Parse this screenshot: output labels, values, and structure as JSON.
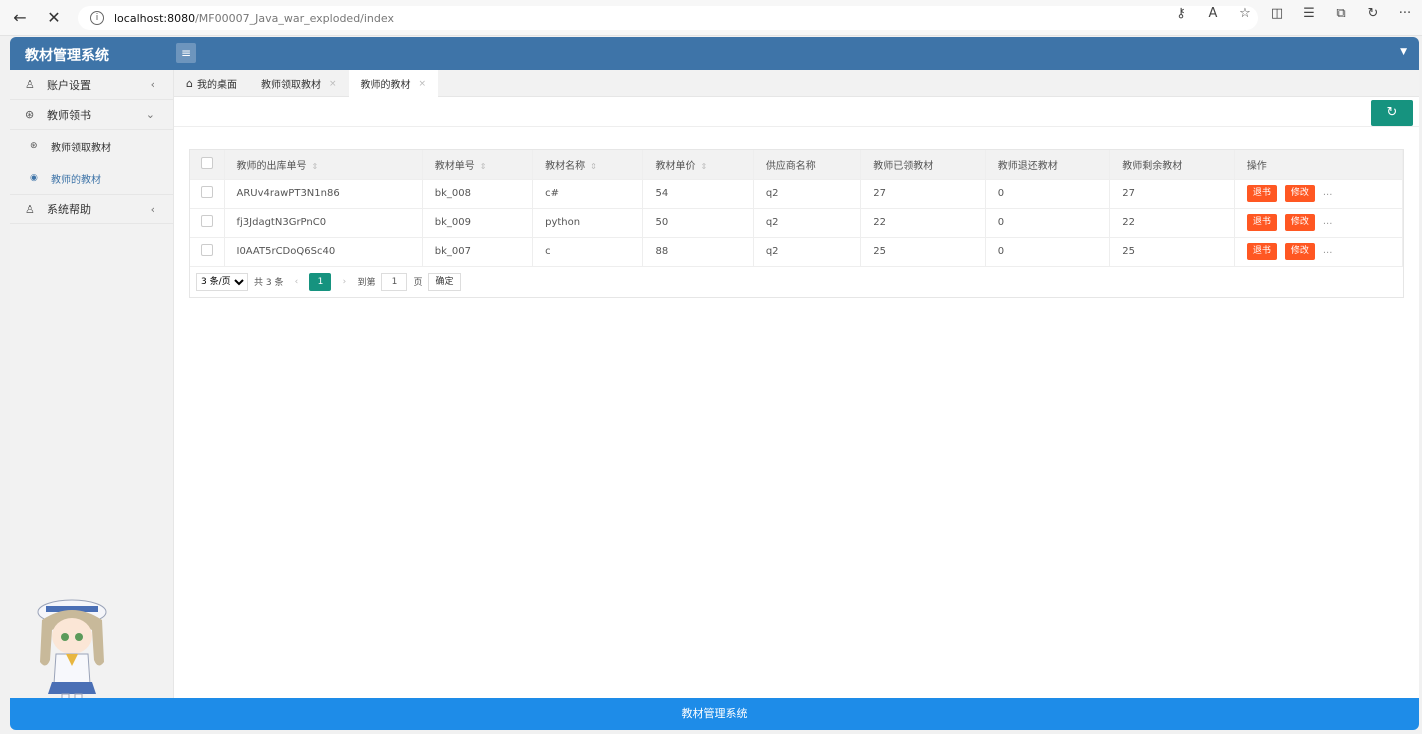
{
  "browser": {
    "back": "←",
    "close": "✕",
    "info": "i",
    "url_host": "localhost:8080",
    "url_path": "/MF00007_Java_war_exploded/index",
    "icons": [
      "key-icon",
      "read-aloud-icon",
      "favorite-icon",
      "split-icon",
      "favorites-list-icon",
      "collections-icon",
      "history-icon",
      "more-icon"
    ],
    "icon_glyphs": [
      "⚷",
      "A",
      "☆",
      "◫",
      "☰",
      "⧉",
      "↻",
      "···"
    ]
  },
  "header": {
    "app_title": "教材管理系统",
    "menu_toggle": "≡",
    "caret": "▼"
  },
  "sidebar": {
    "items": [
      {
        "icon": "user-icon",
        "glyph": "♙",
        "label": "账户设置",
        "arrow": "‹"
      },
      {
        "icon": "books-icon",
        "glyph": "⊛",
        "label": "教师领书",
        "arrow": "⌄"
      }
    ],
    "subitems": [
      {
        "icon": "book-icon",
        "glyph": "⊛",
        "label": "教师领取教材",
        "active": false
      },
      {
        "icon": "circle-icon",
        "glyph": "◉",
        "label": "教师的教材",
        "active": true
      }
    ],
    "help": {
      "icon": "user-icon",
      "glyph": "♙",
      "label": "系统帮助",
      "arrow": "‹"
    }
  },
  "tabs": [
    {
      "label": "我的桌面",
      "home": "⌂",
      "closable": false,
      "active": false
    },
    {
      "label": "教师领取教材",
      "closable": true,
      "active": false
    },
    {
      "label": "教师的教材",
      "closable": true,
      "active": true
    }
  ],
  "tab_close": "×",
  "toolbar": {
    "refresh": "↻"
  },
  "table": {
    "headers": [
      "教师的出库单号",
      "教材单号",
      "教材名称",
      "教材单价",
      "供应商名称",
      "教师已领教材",
      "教师退还教材",
      "教师剩余教材",
      "操作"
    ],
    "sortable": [
      true,
      true,
      true,
      true,
      false,
      false,
      false,
      false,
      false
    ],
    "sort_glyph": "⇕",
    "rows": [
      [
        "ARUv4rawPT3N1n86",
        "bk_008",
        "c#",
        "54",
        "q2",
        "27",
        "0",
        "27"
      ],
      [
        "fj3JdagtN3GrPnC0",
        "bk_009",
        "python",
        "50",
        "q2",
        "22",
        "0",
        "22"
      ],
      [
        "I0AAT5rCDoQ6Sc40",
        "bk_007",
        "c",
        "88",
        "q2",
        "25",
        "0",
        "25"
      ]
    ],
    "return_label": "退书",
    "edit_label": "修改",
    "more_label": "..."
  },
  "pager": {
    "per_page": "3 条/页",
    "total": "共 3 条",
    "prev": "‹",
    "current": "1",
    "next": "›",
    "goto_label": "到第",
    "goto_value": "1",
    "page_unit": "页",
    "confirm": "确定"
  },
  "footer": {
    "text": "教材管理系统"
  }
}
